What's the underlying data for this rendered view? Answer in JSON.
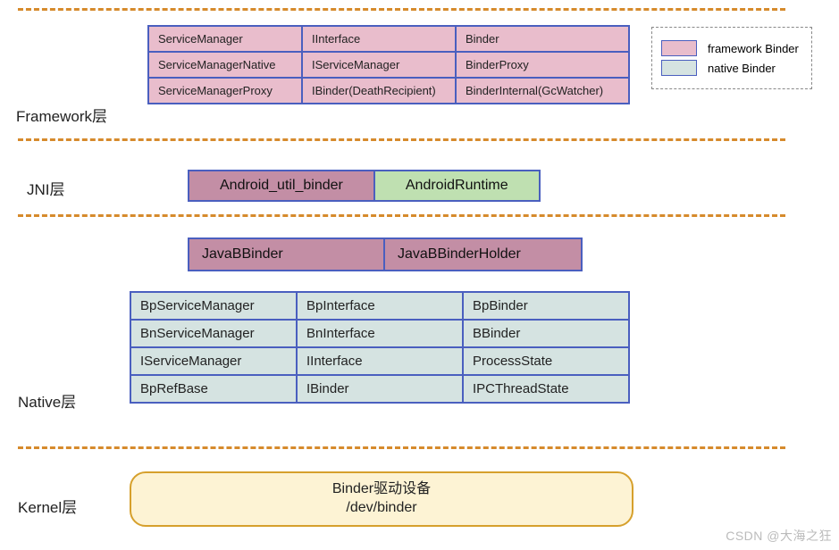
{
  "dividers_y": [
    9,
    155,
    240,
    500
  ],
  "layers": {
    "framework": {
      "label": "Framework层"
    },
    "jni": {
      "label": "JNI层"
    },
    "native": {
      "label": "Native层"
    },
    "kernel": {
      "label": "Kernel层"
    }
  },
  "framework_table": [
    [
      "ServiceManager",
      "IInterface",
      "Binder"
    ],
    [
      "ServiceManagerNative",
      "IServiceManager",
      "BinderProxy"
    ],
    [
      "ServiceManagerProxy",
      "IBinder(DeathRecipient)",
      "BinderInternal(GcWatcher)"
    ]
  ],
  "jni_row": {
    "left": "Android_util_binder",
    "right": "AndroidRuntime"
  },
  "javab_row": [
    "JavaBBinder",
    "JavaBBinderHolder"
  ],
  "native_table": [
    [
      "BpServiceManager",
      "BpInterface",
      "BpBinder"
    ],
    [
      "BnServiceManager",
      "BnInterface",
      "BBinder"
    ],
    [
      "IServiceManager",
      "IInterface",
      "ProcessState"
    ],
    [
      "BpRefBase",
      "IBinder",
      "IPCThreadState"
    ]
  ],
  "kernel_box": {
    "line1": "Binder驱动设备",
    "line2": "/dev/binder"
  },
  "legend": {
    "framework": "framework Binder",
    "native": "native Binder"
  },
  "watermark": "CSDN @大海之狂"
}
